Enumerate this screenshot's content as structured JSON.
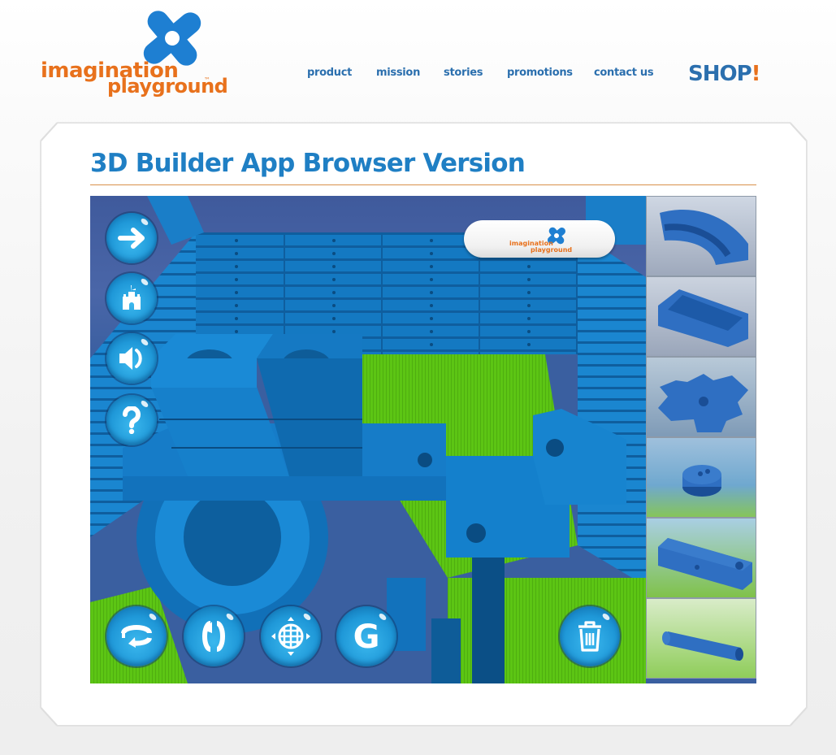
{
  "header": {
    "logo": {
      "line1": "imagination",
      "line2": "playground",
      "trademark": "™",
      "icon": "blue-x-flower-icon"
    },
    "nav": [
      {
        "label": "product"
      },
      {
        "label": "mission"
      },
      {
        "label": "stories"
      },
      {
        "label": "promotions"
      },
      {
        "label": "contact us"
      }
    ],
    "shop": {
      "text": "SHOP",
      "bang": "!",
      "icon": "ball-icon"
    }
  },
  "main": {
    "title": "3D Builder App Browser Version"
  },
  "app": {
    "badge": {
      "line1": "imagination",
      "line2": "playground",
      "trademark": "™"
    },
    "left_controls": [
      {
        "name": "next-arrow",
        "icon": "arrow-right-icon"
      },
      {
        "name": "home",
        "icon": "castle-icon"
      },
      {
        "name": "sound",
        "icon": "speaker-icon"
      },
      {
        "name": "help",
        "icon": "question-mark-icon"
      }
    ],
    "bottom_controls": [
      {
        "name": "rotate-horizontal",
        "icon": "rotate-horizontal-icon"
      },
      {
        "name": "rotate-vertical",
        "icon": "rotate-vertical-icon"
      },
      {
        "name": "pan-view",
        "icon": "globe-move-icon"
      },
      {
        "name": "gravity",
        "icon": "g-letter-icon",
        "label": "G"
      },
      {
        "name": "delete",
        "icon": "trash-icon"
      }
    ],
    "palette": [
      {
        "name": "curved-channel"
      },
      {
        "name": "straight-channel"
      },
      {
        "name": "gear-wheel"
      },
      {
        "name": "round-connector"
      },
      {
        "name": "square-brick"
      },
      {
        "name": "cylinder-rod"
      }
    ]
  },
  "colors": {
    "brand_blue": "#2b6fae",
    "title_blue": "#1f7fc4",
    "brand_orange": "#e8711c",
    "block_blue": "#1a7ec8",
    "grass_green": "#5cc514",
    "sky_blue": "#4a66a8"
  }
}
